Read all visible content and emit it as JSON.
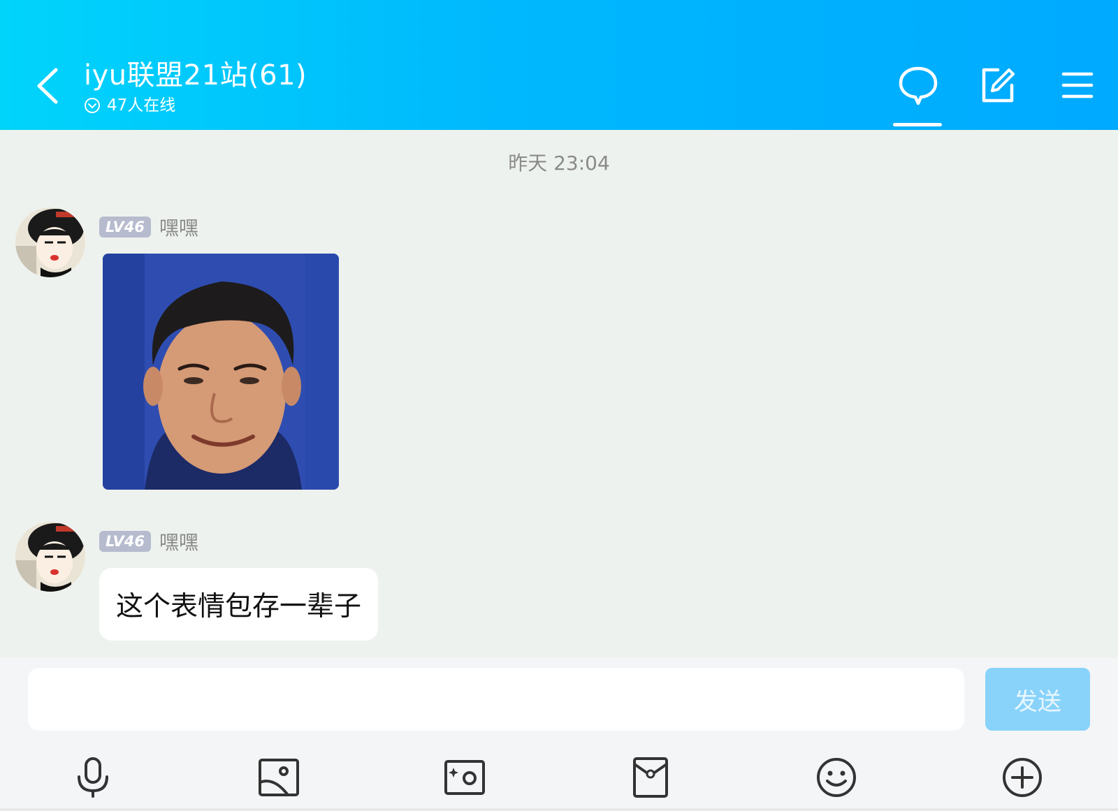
{
  "header": {
    "title": "iyu联盟21站(61)",
    "online_status": "47人在线"
  },
  "chat": {
    "timestamp": "昨天 23:04",
    "messages": [
      {
        "level": "LV46",
        "nickname": "嘿嘿",
        "type": "image"
      },
      {
        "level": "LV46",
        "nickname": "嘿嘿",
        "type": "text",
        "text": "这个表情包存一辈子"
      }
    ]
  },
  "input": {
    "placeholder": "",
    "send_label": "发送"
  },
  "toolbar": {
    "icons": [
      "microphone-icon",
      "image-icon",
      "camera-icon",
      "red-packet-icon",
      "emoji-icon",
      "plus-icon"
    ]
  },
  "colors": {
    "header_start": "#00d4fb",
    "header_end": "#00aaff",
    "send_button": "#89d3fb",
    "chat_background": "#eef2ee",
    "level_badge": "#b6bbce"
  }
}
